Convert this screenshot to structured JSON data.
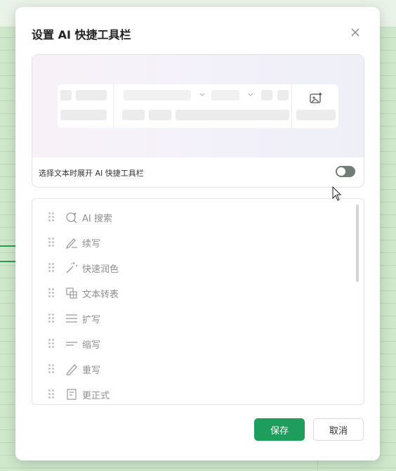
{
  "dialog": {
    "title": "设置 AI 快捷工具栏",
    "close_icon": "close-icon",
    "preview": {
      "toggle_label": "选择文本时展开 AI 快捷工具栏",
      "toggle_on": true,
      "toolbar_icon": "image-sparkle-icon"
    },
    "items": [
      {
        "label": "AI 搜索",
        "icon": "search-sparkle-icon"
      },
      {
        "label": "续写",
        "icon": "pen-icon"
      },
      {
        "label": "快速润色",
        "icon": "magic-wand-icon"
      },
      {
        "label": "文本转表",
        "icon": "text-to-table-icon"
      },
      {
        "label": "扩写",
        "icon": "expand-lines-icon"
      },
      {
        "label": "缩写",
        "icon": "shrink-lines-icon"
      },
      {
        "label": "重写",
        "icon": "pencil-icon"
      },
      {
        "label": "更正式",
        "icon": "document-icon"
      }
    ],
    "buttons": {
      "save": "保存",
      "cancel": "取消"
    },
    "colors": {
      "primary": "#1f9d5c",
      "toggle": "#6f7d74"
    }
  }
}
